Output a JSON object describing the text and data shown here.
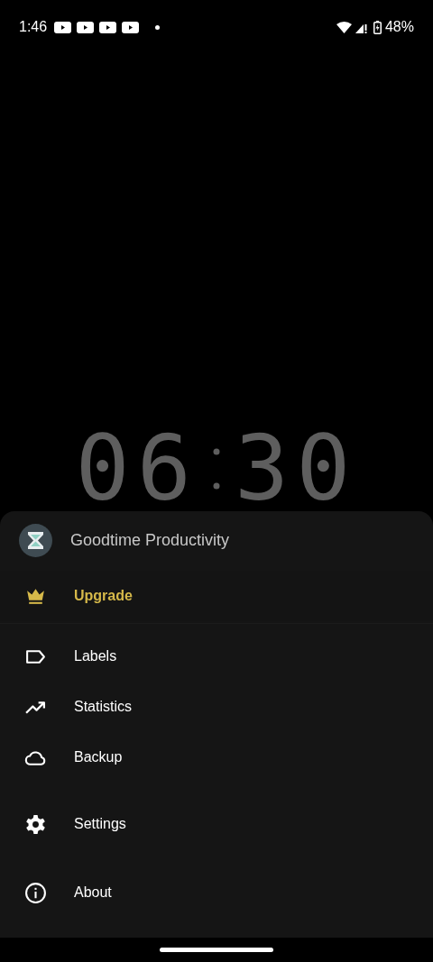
{
  "status_bar": {
    "time": "1:46",
    "battery": "48%"
  },
  "timer": {
    "minutes": "06",
    "seconds": "30"
  },
  "drawer": {
    "app_name": "Goodtime Productivity",
    "groups": [
      [
        {
          "label": "Upgrade",
          "kind": "premium"
        }
      ],
      [
        {
          "label": "Labels",
          "kind": "normal"
        },
        {
          "label": "Statistics",
          "kind": "normal"
        },
        {
          "label": "Backup",
          "kind": "normal"
        }
      ],
      [
        {
          "label": "Settings",
          "kind": "normal"
        }
      ],
      [
        {
          "label": "About",
          "kind": "normal"
        }
      ]
    ]
  }
}
